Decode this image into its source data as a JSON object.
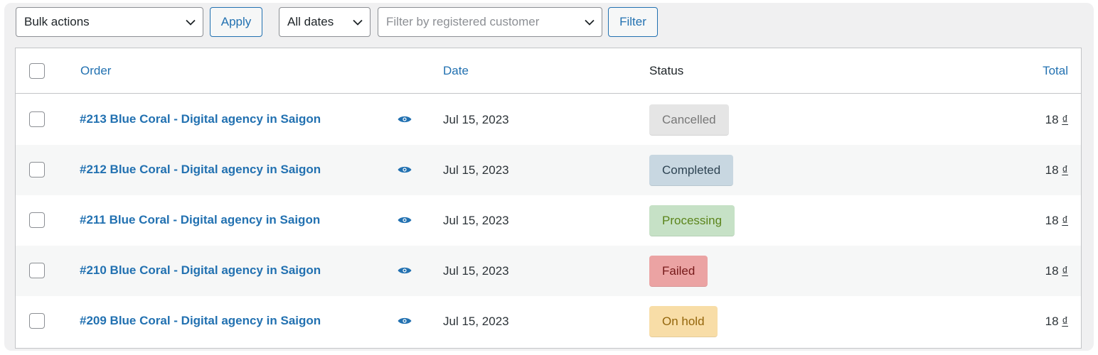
{
  "toolbar": {
    "bulk_actions": "Bulk actions",
    "apply_label": "Apply",
    "dates": "All dates",
    "customer_placeholder": "Filter by registered customer",
    "filter_label": "Filter"
  },
  "table": {
    "columns": {
      "order": "Order",
      "date": "Date",
      "status": "Status",
      "total": "Total"
    },
    "rows": [
      {
        "order": "#213 Blue Coral - Digital agency in Saigon",
        "date": "Jul 15, 2023",
        "status": "Cancelled",
        "total": "18",
        "currency": "₫"
      },
      {
        "order": "#212 Blue Coral - Digital agency in Saigon",
        "date": "Jul 15, 2023",
        "status": "Completed",
        "total": "18",
        "currency": "₫"
      },
      {
        "order": "#211 Blue Coral - Digital agency in Saigon",
        "date": "Jul 15, 2023",
        "status": "Processing",
        "total": "18",
        "currency": "₫"
      },
      {
        "order": "#210 Blue Coral - Digital agency in Saigon",
        "date": "Jul 15, 2023",
        "status": "Failed",
        "total": "18",
        "currency": "₫"
      },
      {
        "order": "#209 Blue Coral - Digital agency in Saigon",
        "date": "Jul 15, 2023",
        "status": "On hold",
        "total": "18",
        "currency": "₫"
      }
    ]
  },
  "status_colors": {
    "Cancelled": {
      "bg": "#e5e5e5",
      "fg": "#777777"
    },
    "Completed": {
      "bg": "#c8d7e1",
      "fg": "#2e4453"
    },
    "Processing": {
      "bg": "#c6e1c6",
      "fg": "#5b841b"
    },
    "Failed": {
      "bg": "#eba3a3",
      "fg": "#761919"
    },
    "On hold": {
      "bg": "#f8dda7",
      "fg": "#94660c"
    }
  },
  "icons": {
    "dropdown": "chevron-down-icon",
    "preview": "eye-icon"
  },
  "accent_color": "#2271b1"
}
